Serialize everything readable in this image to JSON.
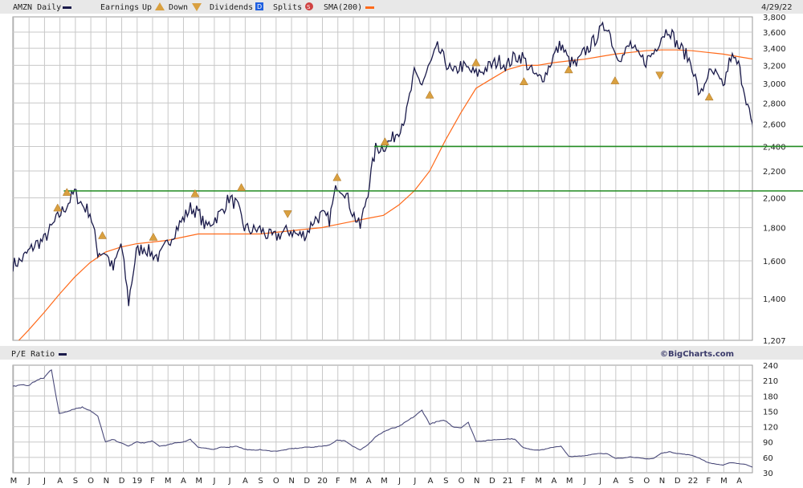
{
  "header": {
    "symbol_label": "AMZN Daily",
    "earnings_label": "Earnings",
    "up_label": "Up",
    "down_label": "Down",
    "dividends_label": "Dividends",
    "dividends_glyph": "D",
    "splits_label": "Splits",
    "splits_glyph": "S",
    "sma_label": "SMA(200)",
    "date": "4/29/22"
  },
  "lower_header": {
    "pe_label": "P/E Ratio",
    "brand": "©BigCharts.com"
  },
  "colors": {
    "price": "#1a1a4a",
    "sma": "#ff6a1a",
    "support": "#228b22",
    "earnings": "#d9a040",
    "grid": "#c8c8c8",
    "band": "#e8e8e8",
    "dividend": "#2060e0",
    "split": "#d04040"
  },
  "chart_data": [
    {
      "type": "line",
      "title": "AMZN Daily",
      "scale": "log",
      "ylim": [
        1207,
        3800
      ],
      "y_ticks": [
        "3,800",
        "3,600",
        "3,400",
        "3,200",
        "3,000",
        "2,800",
        "2,600",
        "2,400",
        "2,200",
        "2,000",
        "1,800",
        "1,600",
        "1,400",
        "1,207"
      ],
      "y_tick_values": [
        3800,
        3600,
        3400,
        3200,
        3000,
        2800,
        2600,
        2400,
        2200,
        2000,
        1800,
        1600,
        1400,
        1207
      ],
      "x_labels": [
        "M",
        "J",
        "J",
        "A",
        "S",
        "O",
        "N",
        "D",
        "19",
        "F",
        "M",
        "A",
        "M",
        "J",
        "J",
        "A",
        "S",
        "O",
        "N",
        "D",
        "20",
        "F",
        "M",
        "A",
        "M",
        "J",
        "J",
        "A",
        "S",
        "O",
        "N",
        "D",
        "21",
        "F",
        "M",
        "A",
        "M",
        "J",
        "J",
        "A",
        "S",
        "O",
        "N",
        "D",
        "22",
        "F",
        "M",
        "A"
      ],
      "x_start": "May 2018",
      "x_end_months": 47.9,
      "series": [
        {
          "name": "AMZN Daily",
          "step_months": 0.5,
          "values": [
            1580,
            1600,
            1650,
            1700,
            1720,
            1800,
            1880,
            1950,
            2040,
            1950,
            1900,
            1650,
            1650,
            1550,
            1700,
            1380,
            1650,
            1680,
            1640,
            1620,
            1700,
            1780,
            1850,
            1930,
            1900,
            1800,
            1850,
            1900,
            2000,
            1950,
            1800,
            1780,
            1790,
            1750,
            1740,
            1770,
            1780,
            1750,
            1760,
            1850,
            1880,
            1850,
            2100,
            2050,
            1900,
            1800,
            2050,
            2380,
            2400,
            2450,
            2550,
            2700,
            3100,
            3000,
            3200,
            3400,
            3250,
            3100,
            3200,
            3150,
            3100,
            3150,
            3200,
            3250,
            3200,
            3300,
            3300,
            3150,
            3050,
            3100,
            3300,
            3450,
            3250,
            3200,
            3350,
            3450,
            3600,
            3700,
            3350,
            3300,
            3450,
            3300,
            3250,
            3350,
            3550,
            3650,
            3450,
            3350,
            3200,
            2850,
            3100,
            3100,
            2950,
            3300,
            3200,
            2850,
            2485
          ]
        },
        {
          "name": "SMA(200)",
          "step_months": 1,
          "values": [
            1180,
            1250,
            1330,
            1420,
            1510,
            1590,
            1650,
            1680,
            1700,
            1710,
            1720,
            1740,
            1760,
            1760,
            1760,
            1760,
            1760,
            1770,
            1780,
            1790,
            1800,
            1820,
            1840,
            1860,
            1880,
            1950,
            2050,
            2200,
            2450,
            2700,
            2950,
            3050,
            3150,
            3200,
            3200,
            3230,
            3250,
            3270,
            3300,
            3330,
            3350,
            3370,
            3380,
            3380,
            3370,
            3350,
            3330,
            3300,
            3270
          ]
        }
      ],
      "horizontal_lines": [
        {
          "value": 2400,
          "from_month": 23.4
        },
        {
          "value": 2050,
          "from_month": 3.3
        }
      ],
      "earnings": [
        {
          "month": 2.9,
          "price": 1930,
          "dir": "up"
        },
        {
          "month": 3.5,
          "price": 2040,
          "dir": "up"
        },
        {
          "month": 5.8,
          "price": 1750,
          "dir": "up"
        },
        {
          "month": 9.1,
          "price": 1740,
          "dir": "up"
        },
        {
          "month": 11.8,
          "price": 2030,
          "dir": "up"
        },
        {
          "month": 14.8,
          "price": 2075,
          "dir": "up"
        },
        {
          "month": 17.8,
          "price": 1890,
          "dir": "down"
        },
        {
          "month": 21.0,
          "price": 2150,
          "dir": "up"
        },
        {
          "month": 24.1,
          "price": 2440,
          "dir": "up"
        },
        {
          "month": 27.0,
          "price": 2880,
          "dir": "up"
        },
        {
          "month": 30.0,
          "price": 3230,
          "dir": "up"
        },
        {
          "month": 33.1,
          "price": 3020,
          "dir": "up"
        },
        {
          "month": 36.0,
          "price": 3150,
          "dir": "up"
        },
        {
          "month": 39.0,
          "price": 3030,
          "dir": "up"
        },
        {
          "month": 41.9,
          "price": 3090,
          "dir": "down"
        },
        {
          "month": 45.1,
          "price": 2860,
          "dir": "up"
        }
      ]
    },
    {
      "type": "line",
      "title": "P/E Ratio",
      "ylim": [
        30,
        240
      ],
      "y_ticks": [
        "240",
        "210",
        "180",
        "150",
        "120",
        "90",
        "60",
        "30"
      ],
      "y_tick_values": [
        240,
        210,
        180,
        150,
        120,
        90,
        60,
        30
      ],
      "series": [
        {
          "name": "P/E Ratio",
          "step_months": 0.5,
          "values": [
            198,
            202,
            200,
            210,
            215,
            232,
            145,
            150,
            155,
            158,
            152,
            140,
            90,
            95,
            88,
            82,
            90,
            88,
            92,
            82,
            84,
            88,
            90,
            95,
            80,
            78,
            75,
            80,
            80,
            82,
            76,
            74,
            75,
            73,
            72,
            74,
            77,
            78,
            80,
            80,
            82,
            84,
            94,
            92,
            82,
            75,
            85,
            100,
            110,
            116,
            120,
            130,
            140,
            152,
            125,
            130,
            132,
            120,
            118,
            128,
            92,
            92,
            94,
            95,
            96,
            96,
            80,
            76,
            74,
            76,
            80,
            82,
            62,
            62,
            63,
            66,
            68,
            67,
            58,
            59,
            61,
            59,
            57,
            58,
            68,
            71,
            68,
            66,
            64,
            58,
            50,
            47,
            45,
            50,
            48,
            46,
            40
          ]
        }
      ]
    }
  ]
}
